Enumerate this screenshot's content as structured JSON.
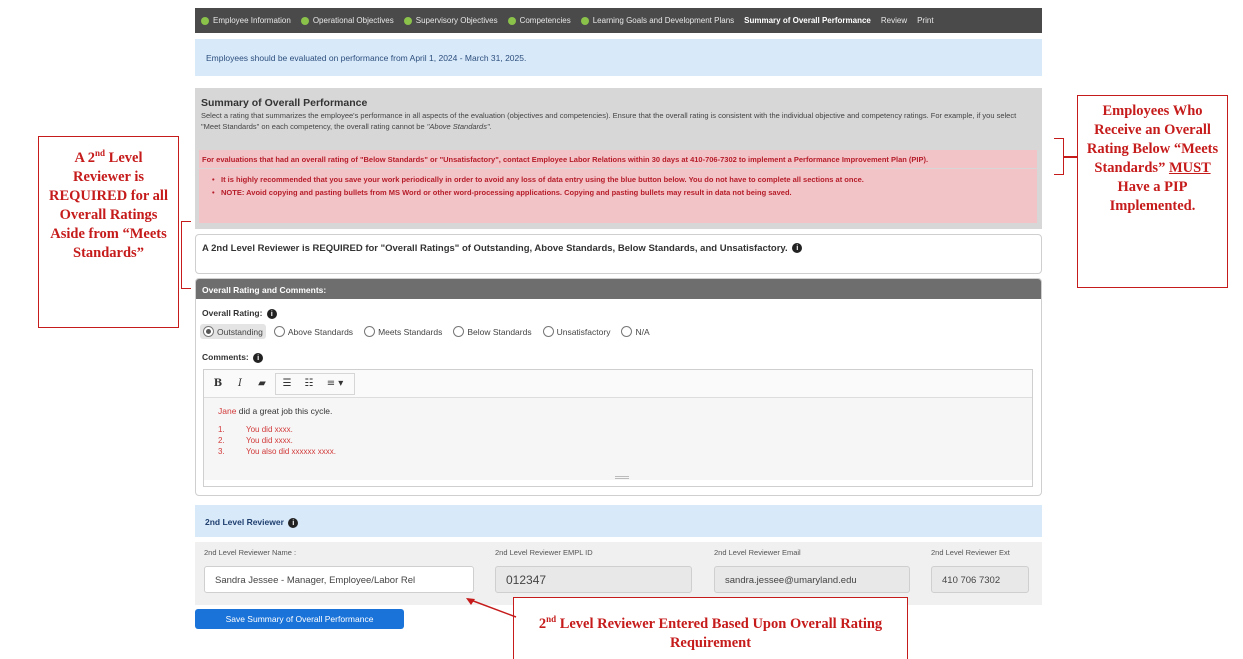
{
  "nav": {
    "items": [
      {
        "label": "Employee Information",
        "dot": true
      },
      {
        "label": "Operational Objectives",
        "dot": true
      },
      {
        "label": "Supervisory Objectives",
        "dot": true
      },
      {
        "label": "Competencies",
        "dot": true
      },
      {
        "label": "Learning Goals and Development Plans",
        "dot": true
      },
      {
        "label": "Summary of Overall Performance",
        "dot": false,
        "active": true
      },
      {
        "label": "Review",
        "dot": false
      },
      {
        "label": "Print",
        "dot": false
      }
    ]
  },
  "info_banner": "Employees should be evaluated on performance from April 1, 2024 - March 31, 2025.",
  "summary": {
    "title": "Summary of Overall Performance",
    "desc_part1": "Select a rating that summarizes the employee's performance in all aspects of the evaluation (objectives and competencies). Ensure that the overall rating is consistent with the individual objective and competency ratings. For example, if you select \"Meet Standards\" on each competency, the overall rating cannot be ",
    "desc_em": "\"Above Standards\".",
    "alert": "For evaluations that had an overall rating of \"Below Standards\" or \"Unsatisfactory\", contact Employee Labor Relations within 30 days at 410-706-7302 to implement a Performance Improvement Plan (PIP).",
    "bullets": [
      "It is highly recommended that you save your work periodically in order to avoid any loss of data entry using the blue button below. You do not have to complete all sections at once.",
      "NOTE: Avoid copying and pasting bullets from MS Word or other word-processing applications. Copying and pasting bullets may result in data not being saved."
    ]
  },
  "required_text": "A 2nd Level Reviewer is REQUIRED for \"Overall Ratings\" of Outstanding, Above Standards, Below Standards, and Unsatisfactory.",
  "rating": {
    "header": "Overall Rating and Comments:",
    "label": "Overall Rating:",
    "options": [
      "Outstanding",
      "Above Standards",
      "Meets Standards",
      "Below Standards",
      "Unsatisfactory",
      "N/A"
    ],
    "selected": "Outstanding",
    "comments_label": "Comments:"
  },
  "editor": {
    "toolbar": {
      "bold": "B",
      "italic": "I",
      "eraser": "▰",
      "ul": "☰",
      "ol": "☷",
      "align": "≡ ▾"
    },
    "name": "Jane",
    "line1_rest": " did a great job this cycle.",
    "list": [
      {
        "num": "1.",
        "text": "You did xxxx."
      },
      {
        "num": "2.",
        "text": "You did xxxx."
      },
      {
        "num": "3.",
        "text": "You also did xxxxxx xxxx."
      }
    ]
  },
  "reviewer": {
    "banner": "2nd Level Reviewer",
    "name_label": "2nd Level Reviewer Name :",
    "name_value": "Sandra Jessee - Manager, Employee/Labor Rel",
    "empl_label": "2nd Level Reviewer EMPL ID",
    "empl_value": "012347",
    "email_label": "2nd Level Reviewer Email",
    "email_value": "sandra.jessee@umaryland.edu",
    "ext_label": "2nd Level Reviewer Ext",
    "ext_value": "410 706 7302"
  },
  "save_button": "Save Summary of Overall Performance",
  "annotations": {
    "left_a": "A 2",
    "left_sup": "nd",
    "left_b": " Level Reviewer is REQUIRED for all Overall Ratings Aside from “Meets Standards”",
    "right_a": "Employees Who Receive an Overall Rating Below “Meets Standards” ",
    "right_u": "MUST",
    "right_b": " Have a PIP Implemented.",
    "bottom_a": "2",
    "bottom_sup": "nd",
    "bottom_b": " Level Reviewer Entered Based Upon Overall Rating Requirement"
  },
  "colors": {
    "accent_red": "#c61b1b",
    "nav_bg": "#4a4a4a",
    "info_blue": "#d8e9fa",
    "save_blue": "#1a73d9",
    "dot_green": "#8ac24a"
  }
}
